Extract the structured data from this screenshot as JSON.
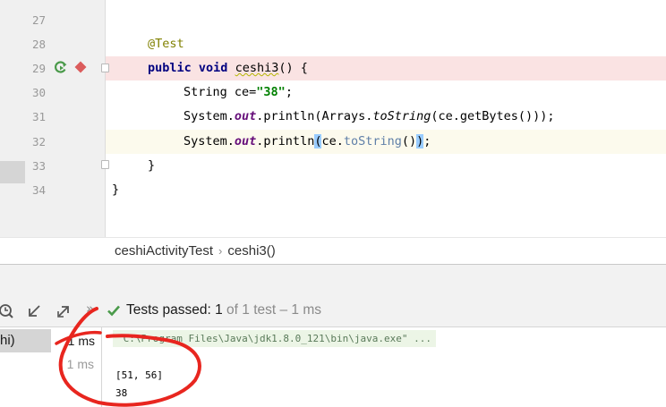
{
  "editor": {
    "lines": [
      {
        "num": "27"
      },
      {
        "num": "28",
        "annotation": "@Test"
      },
      {
        "num": "29",
        "kw_public": "public",
        "kw_void": "void",
        "method": "ceshi3",
        "rest": "() {"
      },
      {
        "num": "30",
        "type": "String",
        "var": " ce=",
        "str": "\"38\"",
        "end": ";"
      },
      {
        "num": "31",
        "pre": "System.",
        "out": "out",
        "mid": ".println(Arrays.",
        "tostr": "toString",
        "post": "(ce.getBytes()));"
      },
      {
        "num": "32",
        "pre": "System.",
        "out": "out",
        "mid": ".println",
        "open": "(",
        "ce": "ce.",
        "tostr": "toString",
        "parens": "()",
        "close": ")",
        "end": ";"
      },
      {
        "num": "33",
        "text": "}"
      },
      {
        "num": "34",
        "text": "}"
      }
    ],
    "run_icon": "run-test-icon",
    "breakpoint_icon": "breakpoint-icon"
  },
  "breadcrumb": {
    "class_name": "ceshiActivityTest",
    "separator": "›",
    "method_name": "ceshi3()"
  },
  "run_panel": {
    "toolbar_icons": [
      "history-icon",
      "import-tests-icon",
      "export-tests-icon"
    ],
    "overflow": "»",
    "status_prefix": "Tests passed:",
    "passed_count": "1",
    "status_suffix": "of 1 test – 1 ms",
    "tree": {
      "row1_label": "hi)",
      "row1_time": "1 ms",
      "row2_time": "1 ms"
    },
    "console": {
      "command": "\"C:\\Program Files\\Java\\jdk1.8.0_121\\bin\\java.exe\" ...",
      "output_line1": "[51, 56]",
      "output_line2": "38"
    }
  },
  "colors": {
    "breakpoint": "#db5c5c",
    "run_check": "#4a9a4a",
    "annotation_circle": "#e8261f"
  }
}
